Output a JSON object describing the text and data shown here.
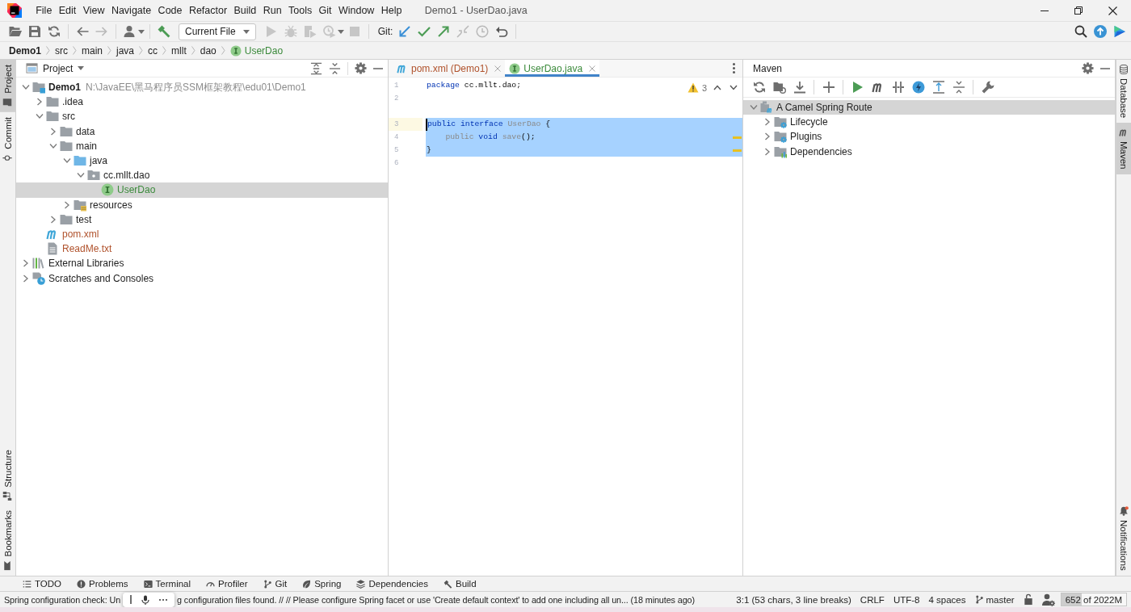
{
  "menu_bar": {
    "items": [
      "File",
      "Edit",
      "View",
      "Navigate",
      "Code",
      "Refactor",
      "Build",
      "Run",
      "Tools",
      "Git",
      "Window",
      "Help"
    ],
    "title": "Demo1 - UserDao.java"
  },
  "toolbar": {
    "run_configuration": "Current File",
    "vcs_label": "Git:"
  },
  "breadcrumbs": [
    {
      "label": "Demo1",
      "kind": "project"
    },
    {
      "label": "src",
      "kind": "folder"
    },
    {
      "label": "main",
      "kind": "folder"
    },
    {
      "label": "java",
      "kind": "folder"
    },
    {
      "label": "cc",
      "kind": "folder"
    },
    {
      "label": "mllt",
      "kind": "folder"
    },
    {
      "label": "dao",
      "kind": "folder"
    },
    {
      "label": "UserDao",
      "kind": "interface",
      "color": "#3b8a3b"
    }
  ],
  "left_stripe": {
    "top": [
      {
        "label": "Project",
        "kind": "project",
        "selected": true
      },
      {
        "label": "Commit",
        "kind": "commit",
        "selected": false
      }
    ],
    "bottom": [
      {
        "label": "Structure",
        "kind": "structure",
        "selected": false
      },
      {
        "label": "Bookmarks",
        "kind": "bookmarks",
        "selected": false
      }
    ]
  },
  "project_panel": {
    "title": "Project",
    "tree": [
      {
        "label": "Demo1",
        "path": "N:\\JavaEE\\黑马程序员SSM框架教程\\edu01\\Demo1",
        "kind": "module",
        "expanded": true,
        "selected": false,
        "children": [
          {
            "label": ".idea",
            "kind": "folder",
            "expanded": false,
            "selected": false
          },
          {
            "label": "src",
            "kind": "folder",
            "expanded": true,
            "selected": false,
            "children": [
              {
                "label": "data",
                "kind": "folder",
                "expanded": false,
                "selected": false
              },
              {
                "label": "main",
                "kind": "folder",
                "expanded": true,
                "selected": false,
                "children": [
                  {
                    "label": "java",
                    "kind": "source_root",
                    "expanded": true,
                    "selected": false,
                    "children": [
                      {
                        "label": "cc.mllt.dao",
                        "kind": "package",
                        "expanded": true,
                        "selected": false,
                        "children": [
                          {
                            "label": "UserDao",
                            "kind": "interface",
                            "color": "#3b8a3b",
                            "selected": true
                          }
                        ]
                      }
                    ]
                  },
                  {
                    "label": "resources",
                    "kind": "resources_root",
                    "expanded": false,
                    "selected": false
                  }
                ]
              },
              {
                "label": "test",
                "kind": "folder",
                "expanded": false,
                "selected": false
              }
            ]
          },
          {
            "label": "pom.xml",
            "kind": "maven",
            "color": "#b0522c",
            "selected": false
          },
          {
            "label": "ReadMe.txt",
            "kind": "text",
            "color": "#b0522c",
            "selected": false
          }
        ]
      },
      {
        "label": "External Libraries",
        "kind": "libraries",
        "expanded": false,
        "selected": false
      },
      {
        "label": "Scratches and Consoles",
        "kind": "scratches",
        "expanded": false,
        "selected": false
      }
    ]
  },
  "editor": {
    "tabs": [
      {
        "label": "pom.xml (Demo1)",
        "kind": "maven",
        "color": "#b0522c",
        "selected": false
      },
      {
        "label": "UserDao.java",
        "kind": "interface",
        "color": "#3b8a3b",
        "selected": true
      }
    ],
    "warning_count": "3",
    "lines": [
      {
        "number": "1",
        "tokens": [
          {
            "text": "package",
            "kind": "keyword"
          },
          {
            "text": " cc.mllt.dao;",
            "kind": "plain"
          }
        ],
        "selected": false,
        "current": false,
        "warning": false
      },
      {
        "number": "2",
        "selected": false,
        "current": false,
        "warning": false
      },
      {
        "number": "3",
        "tokens": [
          {
            "text": "public interface",
            "kind": "keyword"
          },
          {
            "text": " UserDao",
            "kind": "unused"
          },
          {
            "text": " {",
            "kind": "plain"
          }
        ],
        "selected": true,
        "current": true,
        "warning": false,
        "inlay_above": true
      },
      {
        "number": "4",
        "tokens": [
          {
            "text": "    public",
            "kind": "unused"
          },
          {
            "text": " void",
            "kind": "keyword"
          },
          {
            "text": " save",
            "kind": "unused"
          },
          {
            "text": "();",
            "kind": "plain"
          }
        ],
        "selected": true,
        "current": false,
        "warning": true
      },
      {
        "number": "5",
        "tokens": [
          {
            "text": "}",
            "kind": "plain"
          }
        ],
        "selected": true,
        "current": false,
        "warning": true
      },
      {
        "number": "6",
        "selected": false,
        "current": false,
        "warning": false
      }
    ]
  },
  "maven_panel": {
    "title": "Maven",
    "tree": [
      {
        "label": "A Camel Spring Route",
        "kind": "maven_project",
        "expanded": true,
        "selected": true,
        "children": [
          {
            "label": "Lifecycle",
            "kind": "lifecycle",
            "expanded": false,
            "selected": false
          },
          {
            "label": "Plugins",
            "kind": "plugins",
            "expanded": false,
            "selected": false
          },
          {
            "label": "Dependencies",
            "kind": "dependencies",
            "expanded": false,
            "selected": false
          }
        ]
      }
    ]
  },
  "right_stripe": {
    "top": [
      {
        "label": "Database",
        "kind": "database",
        "selected": false
      },
      {
        "label": "Maven",
        "kind": "maven",
        "selected": true
      }
    ],
    "bottom": [
      {
        "label": "Notifications",
        "kind": "notifications",
        "selected": false
      }
    ]
  },
  "tool_windows": [
    {
      "label": "TODO",
      "kind": "todo"
    },
    {
      "label": "Problems",
      "kind": "problems"
    },
    {
      "label": "Terminal",
      "kind": "terminal"
    },
    {
      "label": "Profiler",
      "kind": "profiler"
    },
    {
      "label": "Git",
      "kind": "git"
    },
    {
      "label": "Spring",
      "kind": "spring"
    },
    {
      "label": "Dependencies",
      "kind": "dependencies"
    },
    {
      "label": "Build",
      "kind": "build"
    }
  ],
  "status_bar": {
    "message": [
      "Spring configuration check: Un",
      "g configuration files found. // // Please configure Spring facet or use 'Create default context' to add one including all un... (18 minutes ago)"
    ],
    "caret_position": "3:1 (53 chars, 3 line breaks)",
    "line_separator": "CRLF",
    "encoding": "UTF-8",
    "indent": "4 spaces",
    "branch": "master",
    "memory": {
      "text": "652 of 2022M",
      "level": 0.32
    }
  }
}
